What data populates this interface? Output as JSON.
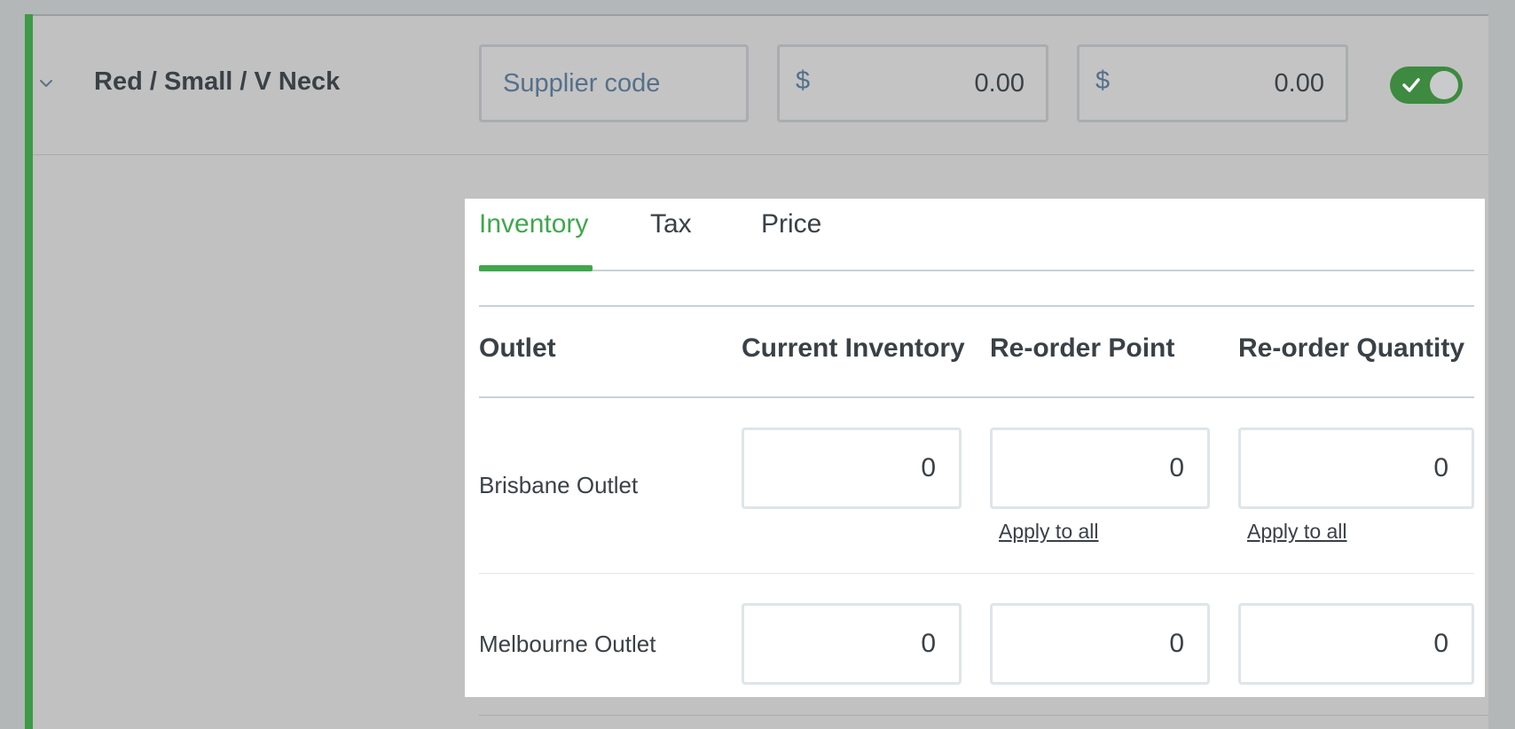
{
  "variant": {
    "name": "Red / Small / V Neck",
    "supplier_code_placeholder": "Supplier code",
    "supplier_code_value": "",
    "currency_symbol": "$",
    "supply_price": "0.00",
    "retail_price": "0.00",
    "enabled": true
  },
  "tabs": [
    {
      "label": "Inventory",
      "active": true
    },
    {
      "label": "Tax",
      "active": false
    },
    {
      "label": "Price",
      "active": false
    }
  ],
  "table": {
    "columns": [
      "Outlet",
      "Current Inventory",
      "Re-order Point",
      "Re-order Quantity"
    ],
    "apply_label": "Apply to all",
    "rows": [
      {
        "outlet": "Brisbane Outlet",
        "current_inventory": "0",
        "reorder_point": "0",
        "reorder_quantity": "0"
      },
      {
        "outlet": "Melbourne Outlet",
        "current_inventory": "0",
        "reorder_point": "0",
        "reorder_quantity": "0"
      }
    ]
  },
  "colors": {
    "accent": "#3fa74c",
    "toggle_on": "#3d8a40",
    "text": "#3a4146"
  },
  "icons": {
    "expand": "chevron-down-icon",
    "toggle": "check-icon"
  }
}
